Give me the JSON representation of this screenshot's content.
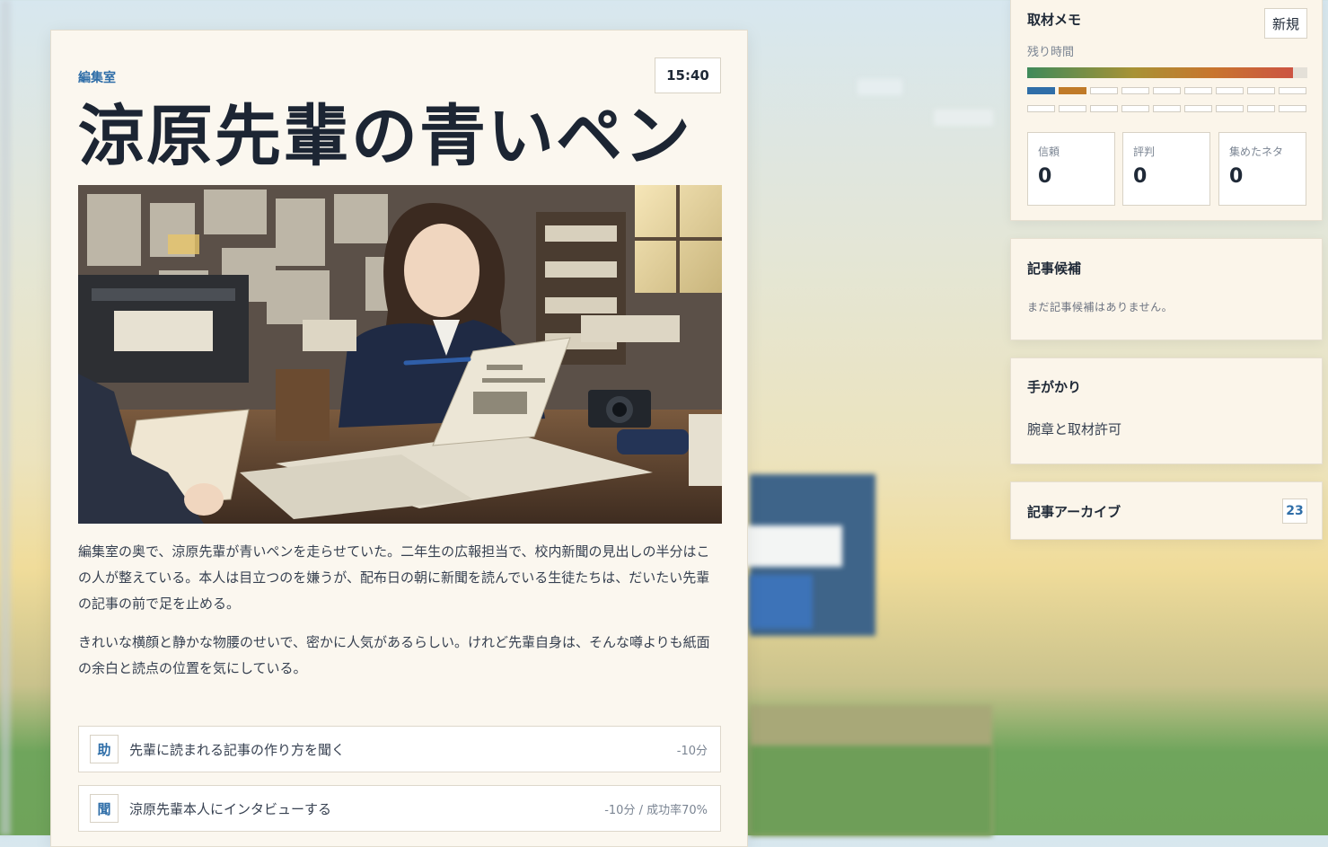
{
  "scene": {
    "location": "編集室",
    "clock": "15:40",
    "title": "涼原先輩の青いペン",
    "paragraphs": [
      "編集室の奥で、涼原先輩が青いペンを走らせていた。二年生の広報担当で、校内新聞の見出しの半分はこの人が整えている。本人は目立つのを嫌うが、配布日の朝に新聞を読んでいる生徒たちは、だいたい先輩の記事の前で足を止める。",
      "きれいな横顔と静かな物腰のせいで、密かに人気があるらしい。けれど先輩自身は、そんな噂よりも紙面の余白と読点の位置を気にしている。"
    ],
    "choices": [
      {
        "key": "助",
        "label": "先輩に読まれる記事の作り方を聞く",
        "cost": "-10分"
      },
      {
        "key": "聞",
        "label": "涼原先輩本人にインタビューする",
        "cost": "-10分 / 成功率70%"
      }
    ]
  },
  "memo": {
    "title": "取材メモ",
    "new_button": "新規",
    "time_label": "残り時間",
    "time_remaining": 0.95,
    "time_color_start": "#3f8a5a",
    "time_color_end": "#cc5443",
    "progress_row1": [
      "blue",
      "orange",
      "empty",
      "empty",
      "empty",
      "empty",
      "empty",
      "empty",
      "empty"
    ],
    "progress_row2": [
      "empty",
      "empty",
      "empty",
      "empty",
      "empty",
      "empty",
      "empty",
      "empty",
      "empty"
    ],
    "stats": [
      {
        "label": "信頼",
        "value": "0"
      },
      {
        "label": "評判",
        "value": "0"
      },
      {
        "label": "集めたネタ",
        "value": "0"
      }
    ]
  },
  "candidates": {
    "title": "記事候補",
    "empty_text": "まだ記事候補はありません。"
  },
  "clues": {
    "title": "手がかり",
    "items": [
      "腕章と取材許可"
    ]
  },
  "archive": {
    "title": "記事アーカイブ",
    "count": "23"
  },
  "colors": {
    "accent_blue": "#2f6ea8",
    "accent_orange": "#c07a28",
    "card_bg": "#fbf7ef"
  }
}
